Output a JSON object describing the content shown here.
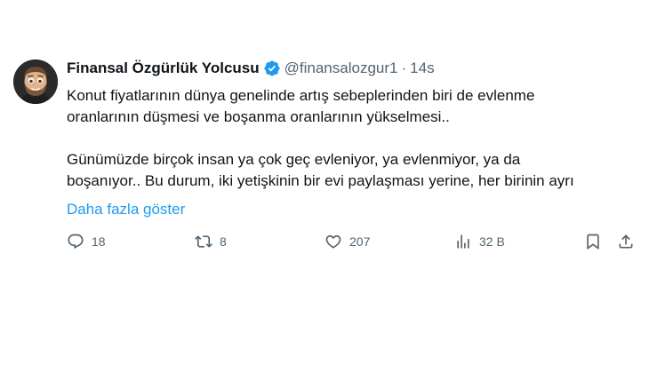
{
  "author": {
    "name": "Finansal Özgürlük Yolcusu",
    "handle": "@finansalozgur1",
    "separator": "·",
    "time": "14s",
    "avatar_icon": "memoji-avatar",
    "verified_icon": "verified-badge-icon",
    "verified_color": "#1d9bf0"
  },
  "tweet": {
    "lines": [
      "Konut fiyatlarının dünya genelinde artış sebeplerinden biri de evlenme",
      "oranlarının düşmesi ve boşanma oranlarının yükselmesi..",
      "",
      "Günümüzde birçok insan ya çok geç evleniyor, ya evlenmiyor, ya da",
      "boşanıyor.. Bu durum, iki yetişkinin bir evi paylaşması yerine, her birinin ayrı"
    ],
    "show_more": "Daha fazla göster",
    "link_color": "#1d9bf0"
  },
  "actions": {
    "replies": {
      "icon": "reply-icon",
      "count": "18"
    },
    "retweets": {
      "icon": "retweet-icon",
      "count": "8"
    },
    "likes": {
      "icon": "heart-icon",
      "count": "207"
    },
    "views": {
      "icon": "views-chart-icon",
      "count": "32 B"
    },
    "bookmark": {
      "icon": "bookmark-icon"
    },
    "share": {
      "icon": "share-icon"
    }
  }
}
